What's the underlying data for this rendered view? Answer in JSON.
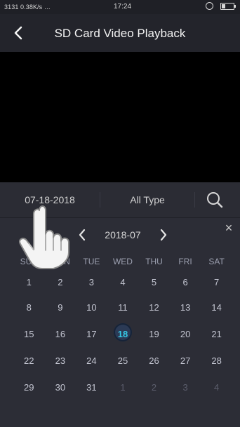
{
  "status": {
    "left": "3131 0.38K/s …",
    "time": "17:24"
  },
  "header": {
    "title": "SD Card Video Playback"
  },
  "filters": {
    "date": "07-18-2018",
    "type": "All Type"
  },
  "calendar": {
    "month_label": "2018-07",
    "close_label": "×",
    "weekdays": [
      "SUN",
      "MON",
      "TUE",
      "WED",
      "THU",
      "FRI",
      "SAT"
    ],
    "weeks": [
      [
        "1",
        "2",
        "3",
        "4",
        "5",
        "6",
        "7"
      ],
      [
        "8",
        "9",
        "10",
        "11",
        "12",
        "13",
        "14"
      ],
      [
        "15",
        "16",
        "17",
        "18",
        "19",
        "20",
        "21"
      ],
      [
        "22",
        "23",
        "24",
        "25",
        "26",
        "27",
        "28"
      ],
      [
        "29",
        "30",
        "31",
        "1",
        "2",
        "3",
        "4"
      ]
    ],
    "selected_day": "18",
    "colors": {
      "selected_text": "#35c8e6",
      "background": "#2c2d36"
    }
  },
  "icons": {
    "back": "back-arrow-icon",
    "search": "search-icon",
    "prev": "chevron-left-icon",
    "next": "chevron-right-icon",
    "close": "close-icon",
    "hand": "pointing-hand-icon"
  }
}
